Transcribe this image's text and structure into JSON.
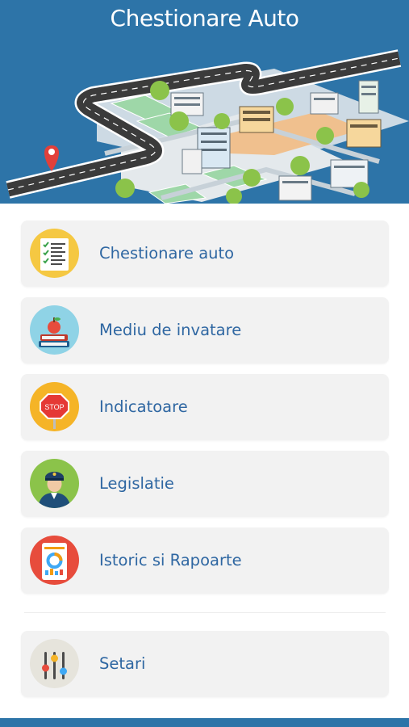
{
  "header": {
    "title": "Chestionare Auto"
  },
  "menu": {
    "items": [
      {
        "label": "Chestionare auto",
        "icon": "checklist-icon"
      },
      {
        "label": "Mediu de invatare",
        "icon": "books-apple-icon"
      },
      {
        "label": "Indicatoare",
        "icon": "stop-sign-icon"
      },
      {
        "label": "Legislatie",
        "icon": "police-officer-icon"
      },
      {
        "label": "Istoric si Rapoarte",
        "icon": "report-chart-icon"
      }
    ],
    "settings": {
      "label": "Setari",
      "icon": "sliders-icon"
    }
  },
  "colors": {
    "header_bg": "#2d74a8",
    "label_text": "#2f67a2",
    "item_bg": "#f2f2f2"
  }
}
